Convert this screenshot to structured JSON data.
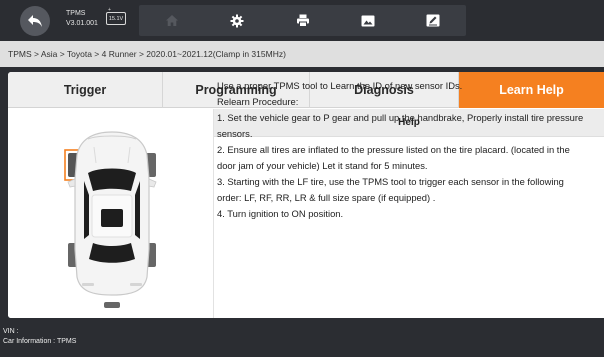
{
  "app": {
    "name": "TPMS",
    "version": "V3.01.001",
    "battery": "15.1V",
    "battery_poles": "+ -"
  },
  "toolbar": {
    "icons": [
      "back-icon",
      "home-icon",
      "gear-icon",
      "printer-icon",
      "image-icon",
      "edit-icon"
    ]
  },
  "breadcrumb": "TPMS > Asia > Toyota > 4 Runner > 2020.01~2021.12(Clamp in 315MHz)",
  "tabs": [
    {
      "label": "Trigger"
    },
    {
      "label": "Programming"
    },
    {
      "label": "Diagnosis"
    },
    {
      "label": "Learn Help",
      "active": true
    }
  ],
  "colors": {
    "accent": "#f58020",
    "background": "#2b2d32",
    "highlight_sensor": "#f58020"
  },
  "help": {
    "title": "Help",
    "lines": [
      "Use a proper TPMS tool to Learn the ID of new sensor IDs.",
      "Relearn Procedure:",
      "1. Set the vehicle gear to P gear and pull up the handbrake, Properly install tire pressure sensors.",
      "2. Ensure all tires are inflated to the pressure listed on the tire placard. (located in the door jam of your vehicle) Let it stand for 5 minutes.",
      "3. Starting with the LF tire, use the TPMS tool to trigger each sensor in the following order: LF, RF, RR, LR & full size spare (if equipped) .",
      "4. Turn ignition to ON position."
    ]
  },
  "footer": {
    "vin": "VIN :",
    "car_info": "Car Information : TPMS"
  }
}
